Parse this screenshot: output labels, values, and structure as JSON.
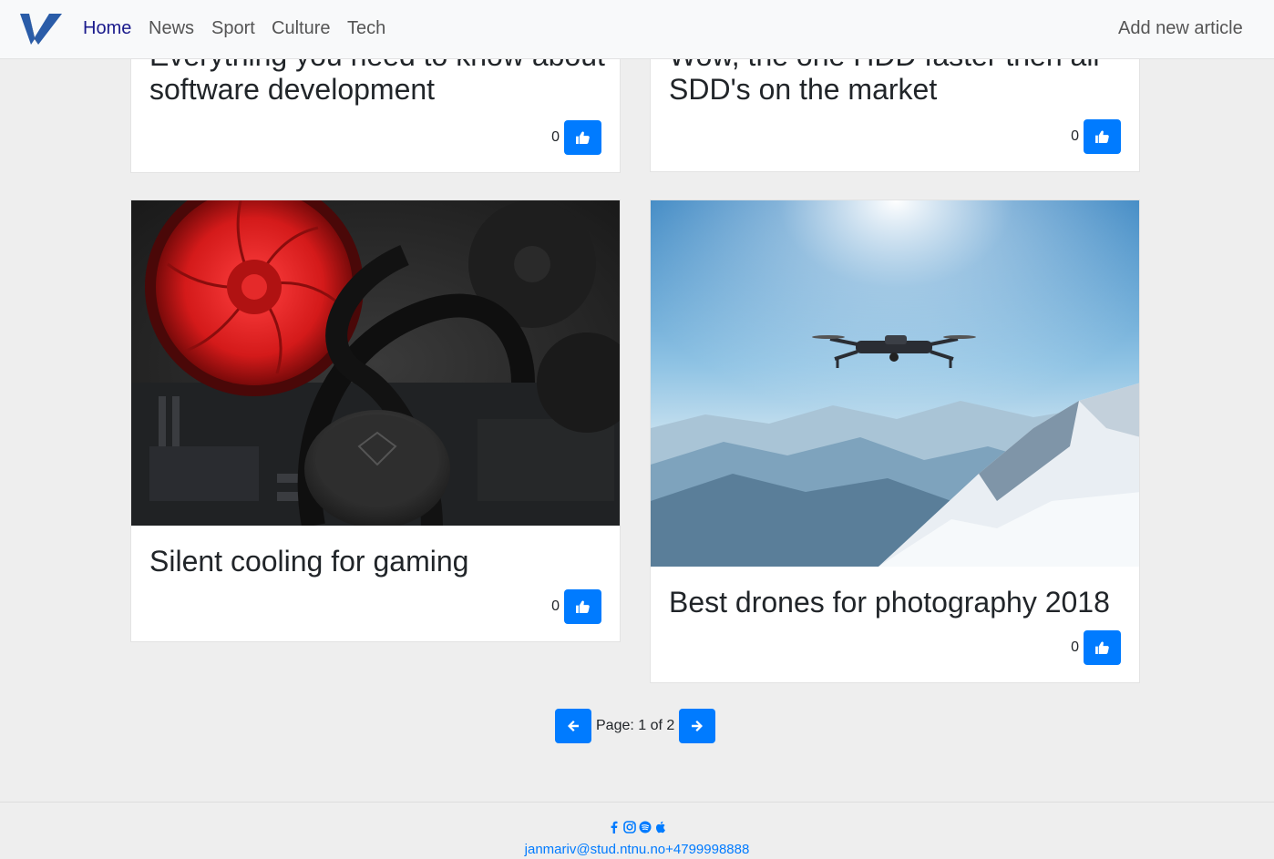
{
  "nav": {
    "items": [
      {
        "label": "Home",
        "active": true
      },
      {
        "label": "News"
      },
      {
        "label": "Sport"
      },
      {
        "label": "Culture"
      },
      {
        "label": "Tech"
      }
    ],
    "add_article": "Add new article"
  },
  "articles": [
    {
      "title": "Everything you need to know about software development",
      "likes": "0"
    },
    {
      "title": "Wow, the one HDD faster then all SDD's on the market",
      "likes": "0"
    },
    {
      "title": "Silent cooling for gaming",
      "likes": "0",
      "image": "red-cooling-fan-photo"
    },
    {
      "title": "Best drones for photography 2018",
      "likes": "0",
      "image": "drone-over-mountains-photo"
    }
  ],
  "pagination": {
    "text": "Page: 1 of 2"
  },
  "footer": {
    "icons": [
      "facebook-icon",
      "instagram-icon",
      "spotify-icon",
      "apple-icon"
    ],
    "contact": "janmariv@stud.ntnu.no+4799998888"
  },
  "colors": {
    "primary": "#007bff",
    "nav_active": "#1a1a8c",
    "logo": "#2a5ca8"
  }
}
